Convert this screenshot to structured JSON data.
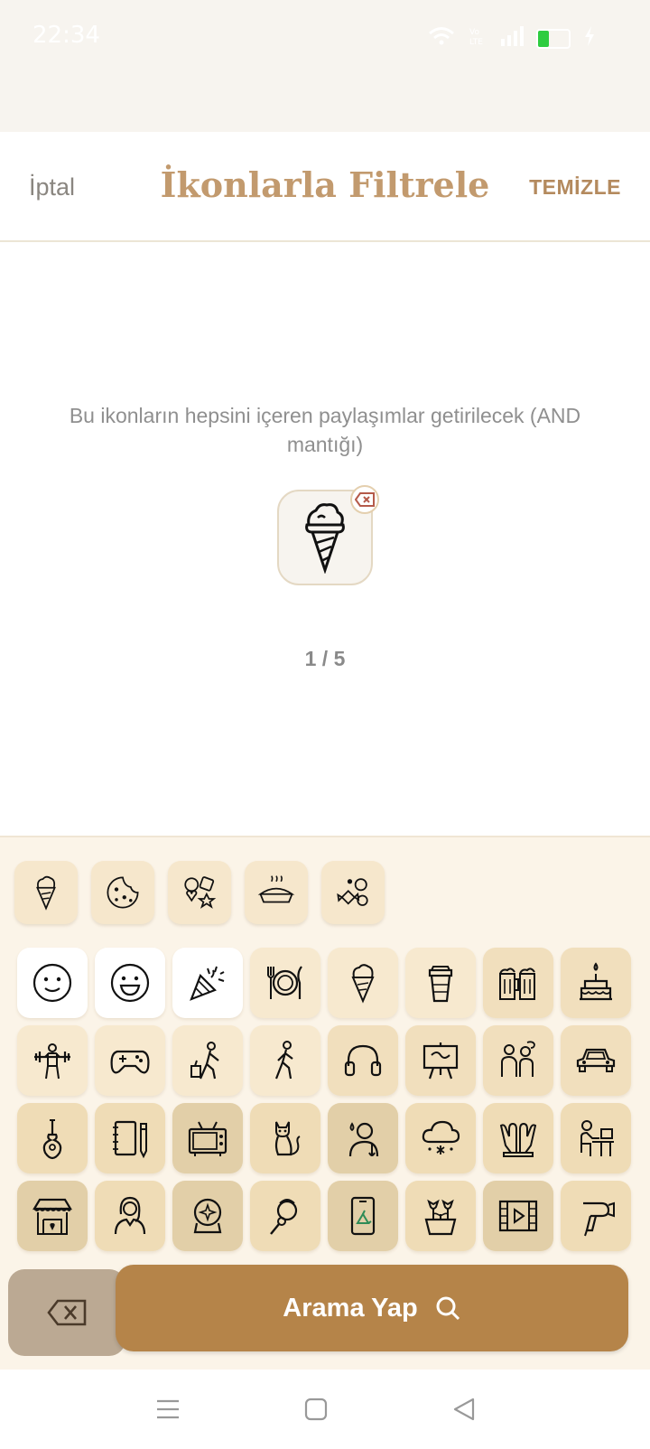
{
  "status_bar": {
    "time": "22:34",
    "icons": [
      "wifi-icon",
      "volte-icon",
      "signal-icon",
      "battery-icon",
      "charging-icon"
    ]
  },
  "header": {
    "cancel_label": "İptal",
    "title": "İkonlarla Filtrele",
    "clear_label": "TEMİZLE"
  },
  "main": {
    "description": "Bu ikonların hepsini içeren paylaşımlar getirilecek (AND mantığı)",
    "selected_icons": [
      "ice-cream"
    ],
    "counter": "1 / 5"
  },
  "keyboard": {
    "recent_icons": [
      "ice-cream",
      "cookie",
      "sweets",
      "pie",
      "candies"
    ],
    "grid_icons": [
      "slightly-smiling-face",
      "grinning-face",
      "party-popper",
      "plate-cutlery",
      "ice-cream",
      "coffee-cup",
      "beer-mugs",
      "birthday-cake",
      "weightlifter",
      "game-controller",
      "traveler-luggage",
      "walking-person",
      "headphones",
      "easel-painting",
      "couple-talking",
      "car",
      "guitar",
      "notebook-pencil",
      "television",
      "cat",
      "sick-person",
      "snow-cloud",
      "praying-hands",
      "person-at-desk",
      "market-stall",
      "woman",
      "snow-globe",
      "person-singing",
      "mobile-recycle",
      "potted-tulips",
      "film-strip",
      "hair-dryer"
    ],
    "search_label": "Arama Yap"
  },
  "colors": {
    "accent": "#b58449",
    "title": "#c29a6e",
    "tile_light": "#f7e9cf",
    "tile_dark": "#e2cfa8",
    "keyboard_bg": "#fbf4e8"
  }
}
